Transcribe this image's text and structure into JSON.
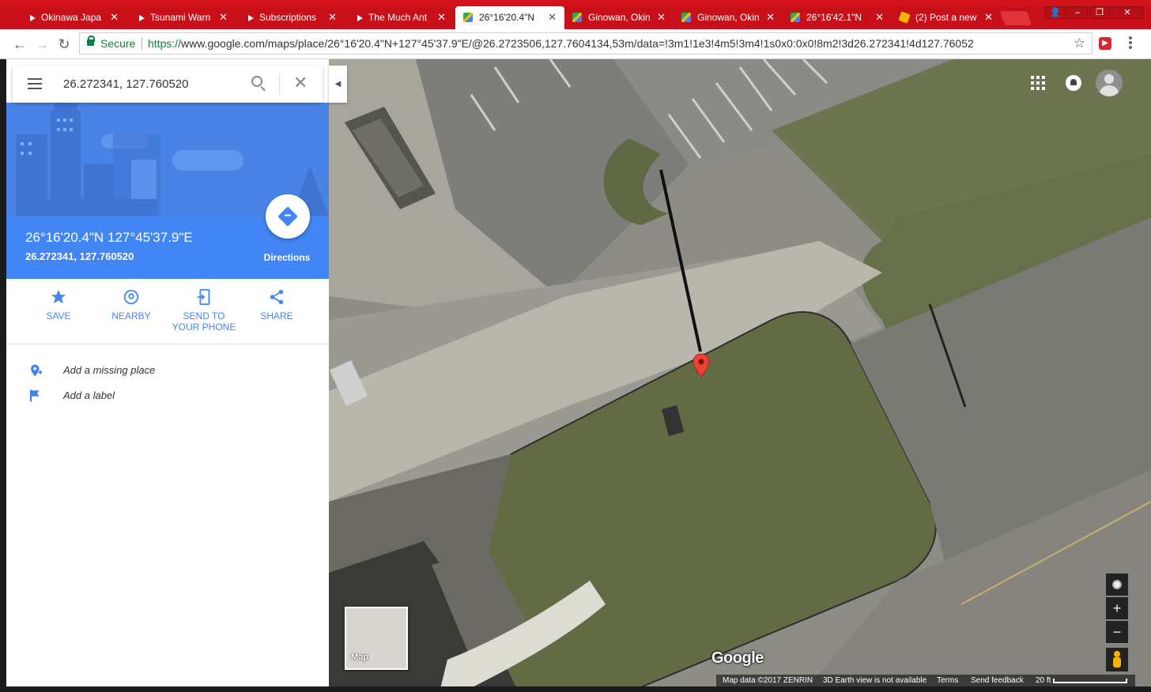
{
  "browser": {
    "tabs": [
      {
        "title": "Okinawa Japa",
        "favicon": "youtube-icon",
        "active": false
      },
      {
        "title": "Tsunami Warn",
        "favicon": "youtube-icon",
        "active": false
      },
      {
        "title": "Subscriptions",
        "favicon": "youtube-icon",
        "active": false
      },
      {
        "title": "The Much Ant",
        "favicon": "youtube-icon",
        "active": false
      },
      {
        "title": "26°16'20.4\"N",
        "favicon": "google-maps-icon",
        "active": true
      },
      {
        "title": "Ginowan, Okin",
        "favicon": "google-maps-icon",
        "active": false
      },
      {
        "title": "Ginowan, Okin",
        "favicon": "google-maps-icon",
        "active": false
      },
      {
        "title": "26°16'42.1\"N",
        "favicon": "google-maps-icon",
        "active": false
      },
      {
        "title": "(2) Post a new",
        "favicon": "post-icon",
        "active": false
      }
    ],
    "secure_label": "Secure",
    "url_scheme": "https://",
    "url_rest": "www.google.com/maps/place/26°16'20.4\"N+127°45'37.9\"E/@26.2723506,127.7604134,53m/data=!3m1!1e3!4m5!3m4!1s0x0:0x0!8m2!3d26.272341!4d127.76052",
    "accent_color": "#c8101a"
  },
  "search": {
    "value": "26.272341, 127.760520"
  },
  "place": {
    "dms": "26°16'20.4\"N 127°45'37.9\"E",
    "decimal": "26.272341, 127.760520",
    "directions_label": "Directions",
    "accent_color": "#4285f4"
  },
  "actions": [
    {
      "label": "SAVE",
      "icon": "star-icon"
    },
    {
      "label": "NEARBY",
      "icon": "nearby-icon"
    },
    {
      "label": "SEND TO YOUR PHONE",
      "icon": "send-to-phone-icon"
    },
    {
      "label": "SHARE",
      "icon": "share-icon"
    }
  ],
  "extras": [
    {
      "label": "Add a missing place",
      "icon": "add-place-icon"
    },
    {
      "label": "Add a label",
      "icon": "flag-icon"
    }
  ],
  "map": {
    "minimap_label": "Map",
    "logo": "Google",
    "footer": {
      "data": "Map data ©2017 ZENRIN",
      "earth": "3D Earth view is not available",
      "terms": "Terms",
      "feedback": "Send feedback",
      "scale": "20 ft"
    }
  }
}
